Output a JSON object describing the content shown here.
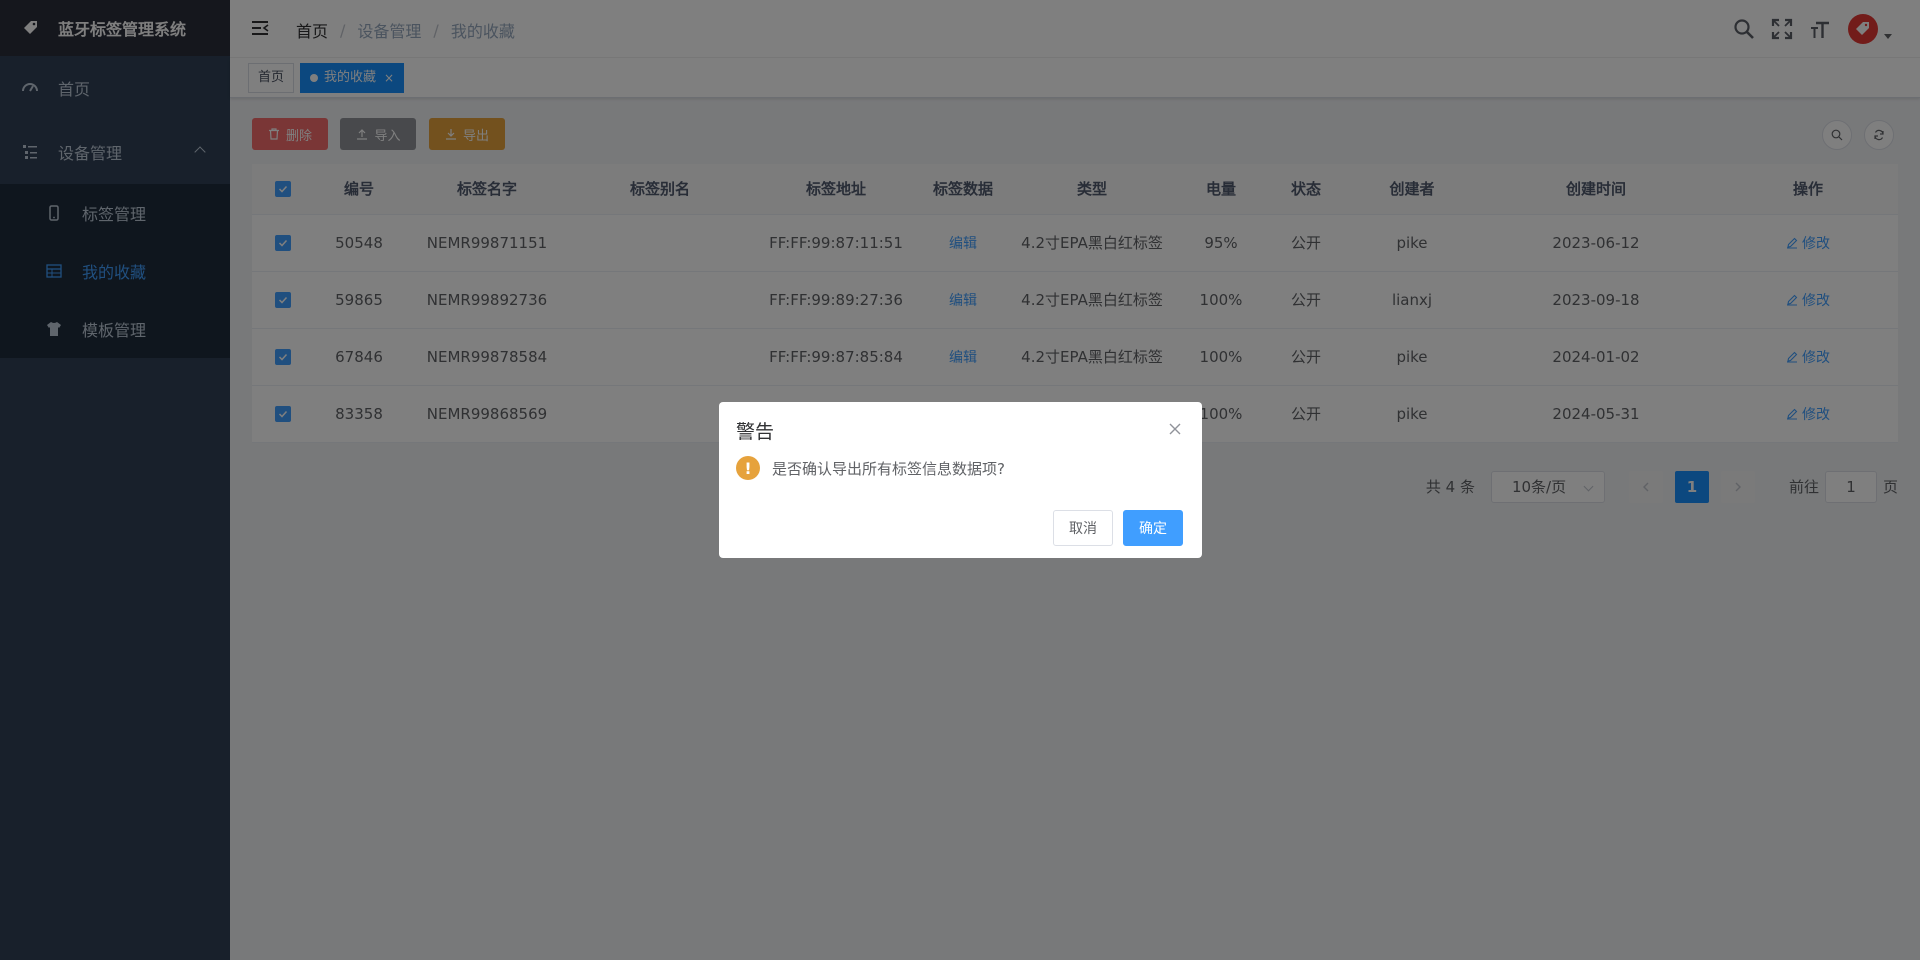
{
  "app": {
    "title": "蓝牙标签管理系统"
  },
  "sidebar": {
    "items": [
      {
        "label": "首页",
        "icon": "dashboard-icon"
      },
      {
        "label": "设备管理",
        "icon": "tree-table-icon"
      }
    ],
    "submenu": [
      {
        "label": "标签管理",
        "icon": "phone-icon",
        "active": false
      },
      {
        "label": "我的收藏",
        "icon": "table-icon",
        "active": true
      },
      {
        "label": "模板管理",
        "icon": "shirt-icon",
        "active": false
      }
    ]
  },
  "navbar": {
    "breadcrumb": [
      "首页",
      "设备管理",
      "我的收藏"
    ],
    "separator": "/"
  },
  "tags": {
    "home": "首页",
    "current": "我的收藏",
    "close": "×"
  },
  "toolbar": {
    "delete_label": "删除",
    "import_label": "导入",
    "export_label": "导出"
  },
  "table": {
    "headers": [
      "编号",
      "标签名字",
      "标签别名",
      "标签地址",
      "标签数据",
      "类型",
      "电量",
      "状态",
      "创建者",
      "创建时间",
      "操作"
    ],
    "rows": [
      {
        "id": "50548",
        "name": "NEMR99871151",
        "alias": "",
        "address": "FF:FF:99:87:11:51",
        "data": "编辑",
        "type": "4.2寸EPA黑白红标签",
        "battery": "95%",
        "status": "公开",
        "creator": "pike",
        "created": "2023-06-12",
        "action": "修改"
      },
      {
        "id": "59865",
        "name": "NEMR99892736",
        "alias": "",
        "address": "FF:FF:99:89:27:36",
        "data": "编辑",
        "type": "4.2寸EPA黑白红标签",
        "battery": "100%",
        "status": "公开",
        "creator": "lianxj",
        "created": "2023-09-18",
        "action": "修改"
      },
      {
        "id": "67846",
        "name": "NEMR99878584",
        "alias": "",
        "address": "FF:FF:99:87:85:84",
        "data": "编辑",
        "type": "4.2寸EPA黑白红标签",
        "battery": "100%",
        "status": "公开",
        "creator": "pike",
        "created": "2024-01-02",
        "action": "修改"
      },
      {
        "id": "83358",
        "name": "NEMR99868569",
        "alias": "",
        "address": "",
        "data": "",
        "type": "",
        "battery": "100%",
        "status": "公开",
        "creator": "pike",
        "created": "2024-05-31",
        "action": "修改"
      }
    ]
  },
  "pagination": {
    "total": "共 4 条",
    "page_size": "10条/页",
    "current_page": "1",
    "goto_prefix": "前往",
    "goto_value": "1",
    "goto_suffix": "页"
  },
  "dialog": {
    "title": "警告",
    "message": "是否确认导出所有标签信息数据项?",
    "cancel": "取消",
    "confirm": "确定"
  },
  "colors": {
    "sidebar_bg": "#304156",
    "active": "#409eff",
    "danger": "#f56c6c",
    "info": "#909399",
    "warning": "#e6a23c"
  }
}
